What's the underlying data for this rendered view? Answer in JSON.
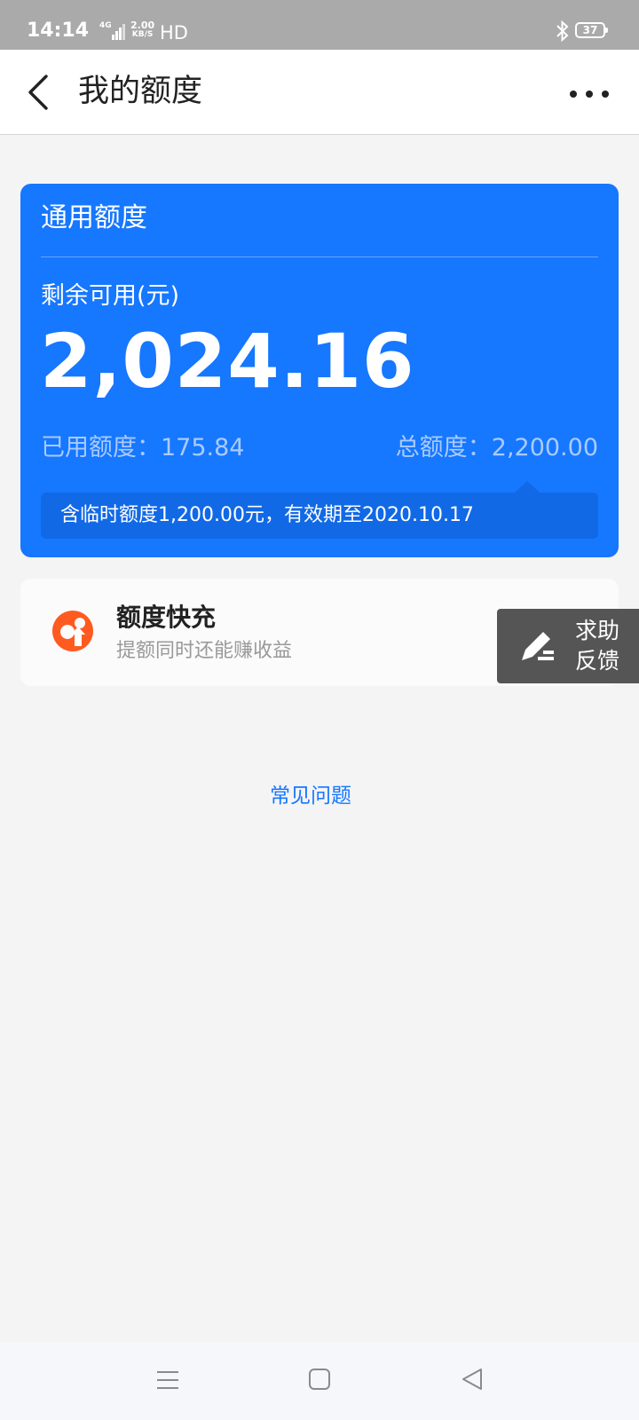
{
  "status_bar": {
    "time": "14:14",
    "network": "4G",
    "speed_value": "2.00",
    "speed_unit": "KB/S",
    "hd": "HD",
    "battery": "37",
    "bluetooth_icon": "bluetooth-icon"
  },
  "header": {
    "title": "我的额度",
    "back_icon": "chevron-left-icon",
    "more_icon": "more-dots-icon"
  },
  "credit_card": {
    "title": "通用额度",
    "remaining_label": "剩余可用(元)",
    "remaining_value": "2,024.16",
    "used_text": "已用额度：175.84",
    "total_text": "总额度：2,200.00",
    "notice": "含临时额度1,200.00元，有效期至2020.10.17",
    "color": "#1677ff"
  },
  "quick_recharge": {
    "title": "额度快充",
    "subtitle": "提额同时还能赚收益",
    "icon": "quick-recharge-icon",
    "icon_color": "#ff5a1f"
  },
  "feedback": {
    "line1": "求助",
    "line2": "反馈",
    "icon": "edit-pen-icon"
  },
  "faq_link": "常见问题",
  "nav_bar": {
    "menu_icon": "menu-icon",
    "home_icon": "home-square-icon",
    "back_icon": "back-triangle-icon"
  }
}
